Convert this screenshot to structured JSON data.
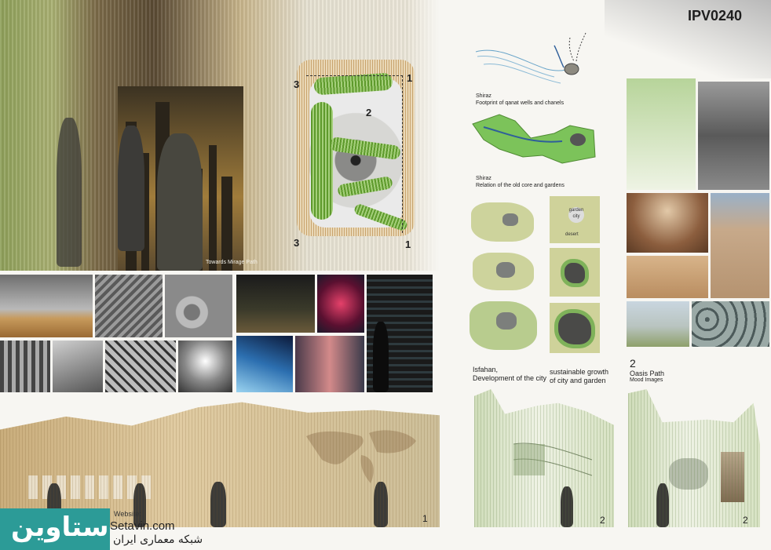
{
  "board_code": "IPV0240",
  "hero": {
    "caption": "Towards Mirage Path"
  },
  "site_plan": {
    "labels": [
      "1",
      "2",
      "3",
      "3",
      "1"
    ]
  },
  "shiraz": {
    "map1_caption": [
      "Shiraz",
      "Footprint of qanat wells and chanels"
    ],
    "map2_caption": [
      "Shiraz",
      "Relation of the old core and gardens"
    ]
  },
  "isfahan": {
    "caption": [
      "Isfahan,",
      "Development of the city"
    ],
    "diagram_text": [
      "garden",
      "city",
      "desert"
    ]
  },
  "sustainable": {
    "caption": [
      "sustainable growth",
      "of city and garden"
    ]
  },
  "oasis": {
    "number": "2",
    "title": "Oasis Path",
    "subtitle": "Mood Images"
  },
  "elevations": {
    "panel1": "1",
    "panel2": "2",
    "panel3": "2"
  },
  "watermark": {
    "logo": "ستاوین",
    "website_label": "Website:",
    "url": "Setavin.com",
    "subtitle": "شبکه معماری ایران"
  },
  "colors": {
    "teal": "#2c9b97",
    "green": "#5e9a2c",
    "gold": "#c9ad7c"
  }
}
